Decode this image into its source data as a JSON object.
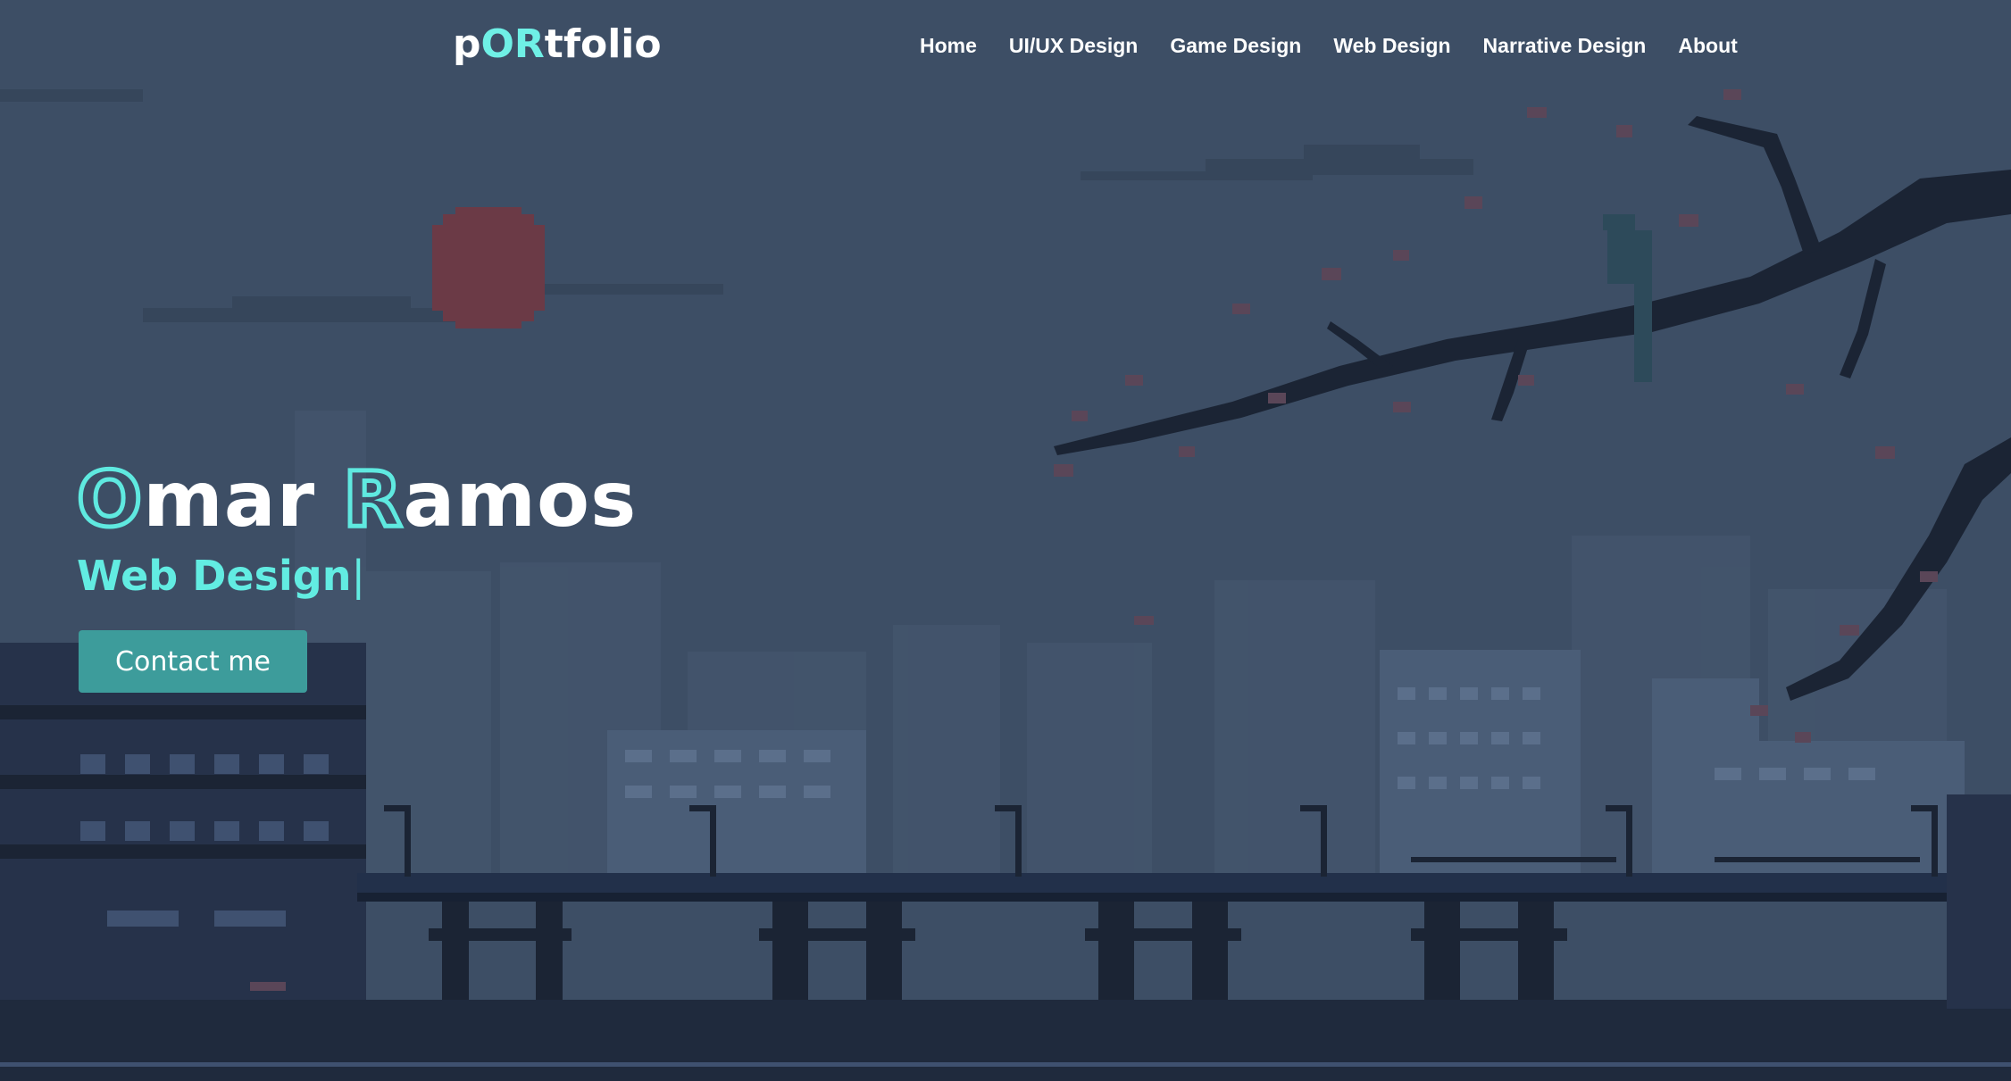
{
  "logo": {
    "prefix": "p",
    "accent": "OR",
    "suffix": "tfolio"
  },
  "nav": {
    "items": [
      {
        "label": "Home"
      },
      {
        "label": "UI/UX Design"
      },
      {
        "label": "Game Design"
      },
      {
        "label": "Web Design"
      },
      {
        "label": "Narrative Design"
      },
      {
        "label": "About"
      }
    ]
  },
  "hero": {
    "first_initial": "O",
    "first_rest": "mar",
    "last_initial": "R",
    "last_rest": "amos",
    "role": "Web Design",
    "cursor": "|",
    "contact_label": "Contact me"
  },
  "colors": {
    "background": "#3c4d64",
    "accent": "#5fe9e0",
    "button": "#3d9c9b",
    "sun": "#6b3a46",
    "silhouette": "#1b2434"
  }
}
